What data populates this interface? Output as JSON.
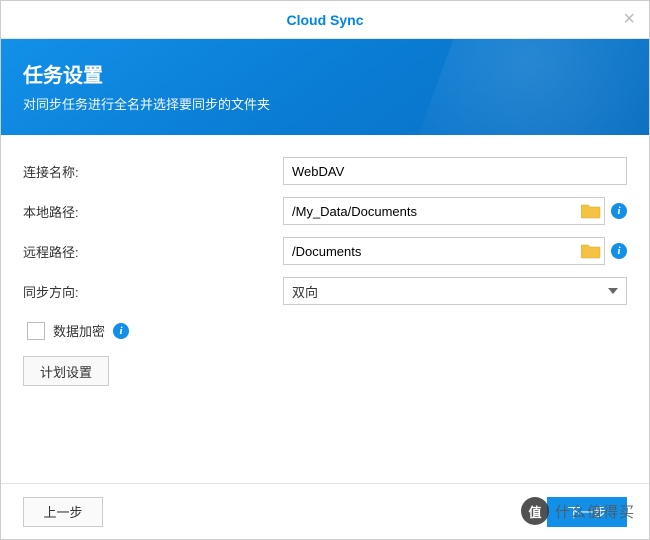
{
  "window": {
    "title": "Cloud Sync"
  },
  "banner": {
    "title": "任务设置",
    "subtitle": "对同步任务进行全名并选择要同步的文件夹"
  },
  "form": {
    "connection_name": {
      "label": "连接名称:",
      "value": "WebDAV"
    },
    "local_path": {
      "label": "本地路径:",
      "value": "/My_Data/Documents"
    },
    "remote_path": {
      "label": "远程路径:",
      "value": "/Documents"
    },
    "sync_direction": {
      "label": "同步方向:",
      "selected": "双向"
    },
    "encryption": {
      "label": "数据加密",
      "checked": false
    },
    "schedule_button": "计划设置"
  },
  "footer": {
    "back": "上一步",
    "next": "下一步"
  },
  "watermark": {
    "badge": "值",
    "text": "什么值得买"
  }
}
